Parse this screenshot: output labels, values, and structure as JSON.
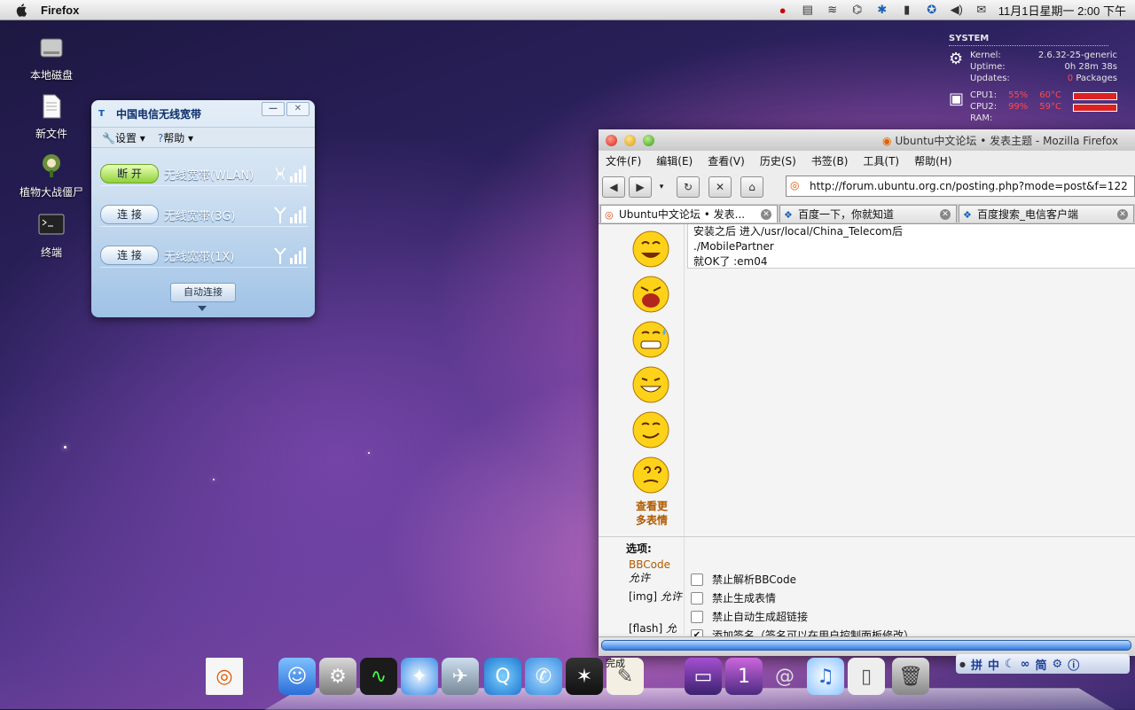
{
  "menubar": {
    "app_name": "Firefox",
    "datetime": "11月1日星期一  2:00 下午"
  },
  "desktop_icons": [
    {
      "label": "本地磁盘",
      "icon": "hard-disk-icon"
    },
    {
      "label": "新文件",
      "icon": "document-icon"
    },
    {
      "label": "植物大战僵尸",
      "icon": "game-icon"
    },
    {
      "label": "终端",
      "icon": "terminal-icon"
    }
  ],
  "sysmon": {
    "title": "SYSTEM",
    "kernel_label": "Kernel:",
    "kernel_value": "2.6.32-25-generic",
    "uptime_label": "Uptime:",
    "uptime_value": "0h 28m 38s",
    "updates_label": "Updates:",
    "updates_count": "0",
    "updates_suffix": "Packages",
    "cpu1_label": "CPU1:",
    "cpu1_pct": "55%",
    "cpu1_temp": "60°C",
    "cpu2_label": "CPU2:",
    "cpu2_pct": "99%",
    "cpu2_temp": "59°C",
    "ram_label": "RAM:"
  },
  "telecom": {
    "title": "中国电信无线宽带",
    "menu_settings": "设置",
    "menu_help": "帮助",
    "connections": [
      {
        "button": "断 开",
        "label": "无线宽带(WLAN)"
      },
      {
        "button": "连 接",
        "label": "无线宽带(3G)"
      },
      {
        "button": "连 接",
        "label": "无线宽带(1X)"
      }
    ],
    "auto_connect": "自动连接"
  },
  "firefox": {
    "window_title": "Ubuntu中文论坛 • 发表主题 - Mozilla Firefox",
    "menus": [
      "文件(F)",
      "编辑(E)",
      "查看(V)",
      "历史(S)",
      "书签(B)",
      "工具(T)",
      "帮助(H)"
    ],
    "url": "http://forum.ubuntu.org.cn/posting.php?mode=post&f=122",
    "tabs": [
      {
        "title": "Ubuntu中文论坛 • 发表..."
      },
      {
        "title": "百度一下，你就知道"
      },
      {
        "title": "百度搜索_电信客户端"
      }
    ],
    "post_lines": [
      "安装之后  进入/usr/local/China_Telecom后",
      "./MobilePartner",
      "就OK了  :em04"
    ],
    "more_smilies_1": "查看更",
    "more_smilies_2": "多表情",
    "options_title": "选项:",
    "option_labels": [
      {
        "name": "BBCode",
        "suffix": "允许"
      },
      {
        "name": "[img]",
        "suffix": "允许"
      },
      {
        "name": "[flash]",
        "suffix": "允许"
      }
    ],
    "checkboxes": [
      {
        "label": "禁止解析BBCode",
        "checked": false
      },
      {
        "label": "禁止生成表情",
        "checked": false
      },
      {
        "label": "禁止自动生成超链接",
        "checked": false
      },
      {
        "label": "添加签名（签名可以在用户控制面板修改）",
        "checked": true
      }
    ],
    "status_text": "完成"
  },
  "ime": {
    "items": [
      "拼",
      "中"
    ]
  }
}
